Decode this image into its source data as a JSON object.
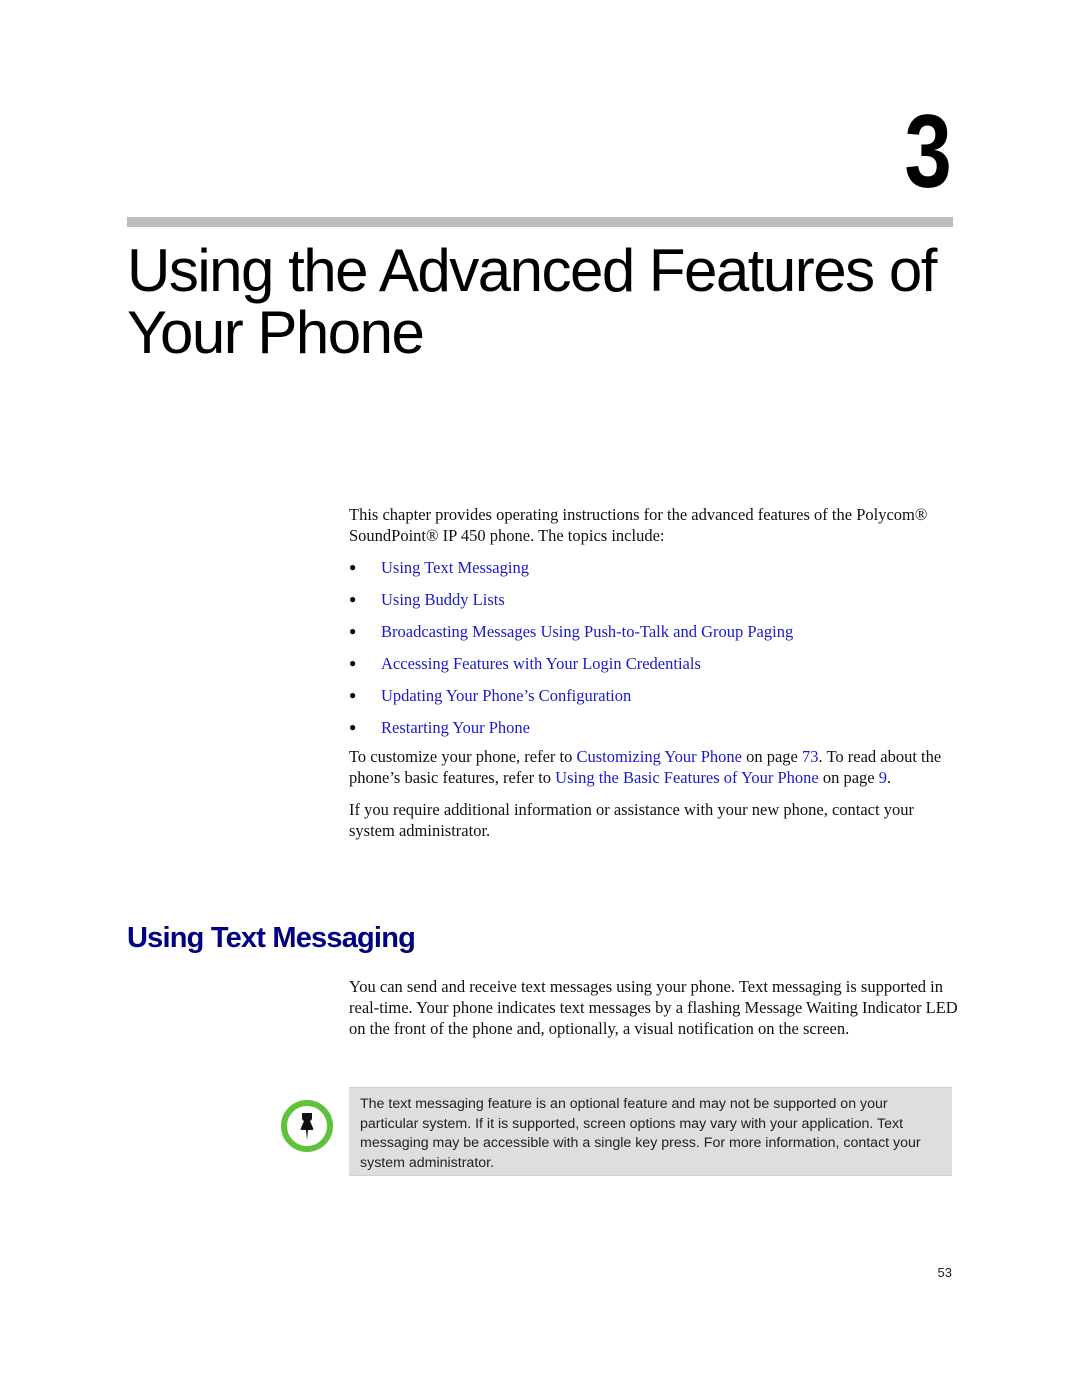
{
  "chapter": {
    "number": "3",
    "title": "Using the Advanced Features of Your Phone"
  },
  "intro": {
    "paragraph1": "This chapter provides operating instructions for the advanced features of the Polycom® SoundPoint® IP 450 phone. The topics include:",
    "topics": [
      {
        "label": "Using Text Messaging"
      },
      {
        "label": "Using Buddy Lists"
      },
      {
        "label": "Broadcasting Messages Using Push-to-Talk and Group Paging"
      },
      {
        "label": "Accessing Features with Your Login Credentials"
      },
      {
        "label": "Updating Your Phone’s Configuration"
      },
      {
        "label": "Restarting Your Phone"
      }
    ],
    "paragraph2": {
      "t1": "To customize your phone, refer to ",
      "link1": "Customizing Your Phone",
      "t2": " on page ",
      "page1": "73",
      "t3": ". To read about the phone’s basic features, refer to ",
      "link2": "Using the Basic Features of Your Phone",
      "t4": " on page ",
      "page2": "9",
      "t5": "."
    },
    "paragraph3": "If you require additional information or assistance with your new phone, contact your system administrator."
  },
  "section": {
    "heading": "Using Text Messaging",
    "paragraph": "You can send and receive text messages using your phone. Text messaging is supported in real-time. Your phone indicates text messages by a flashing Message Waiting Indicator LED on the front of the phone and, optionally, a visual notification on the screen.",
    "note": {
      "icon": "pushpin-icon",
      "text": "The text messaging feature is an optional feature and may not be supported on your particular system. If it is supported, screen options may vary with your application. Text messaging may be accessible with a single key press. For more information, contact your system administrator."
    }
  },
  "colors": {
    "link": "#1a1acc",
    "heading": "#000080",
    "rule": "#bdbdbd",
    "note_bg": "#dedede",
    "note_icon": "#5ec33a"
  },
  "footer": {
    "page_number": "53"
  }
}
